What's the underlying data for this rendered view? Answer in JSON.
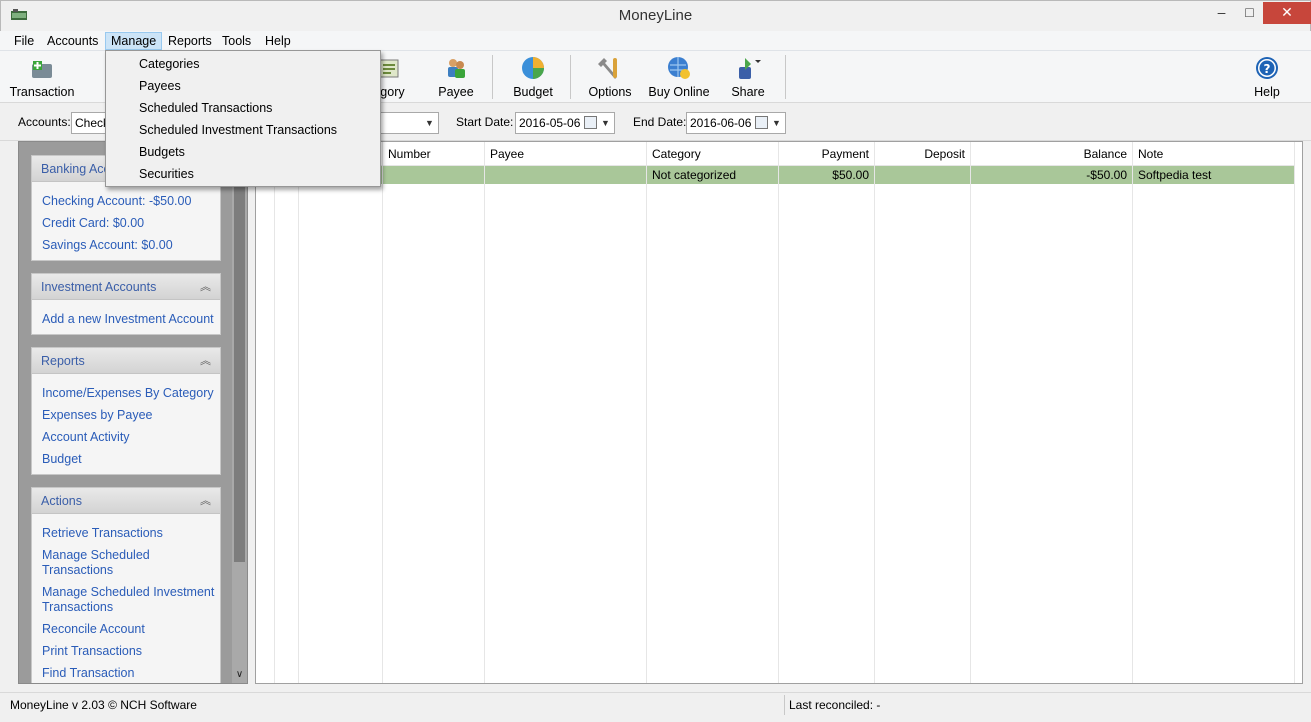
{
  "window": {
    "title": "MoneyLine",
    "min": "–",
    "max": "□",
    "close": "✕"
  },
  "menubar": {
    "items": [
      "File",
      "Accounts",
      "Manage",
      "Reports",
      "Tools",
      "Help"
    ]
  },
  "toolbar": {
    "items": [
      {
        "label": "Transaction",
        "icon": "transaction-icon"
      },
      {
        "label": "egory",
        "icon": "category-icon"
      },
      {
        "label": "Payee",
        "icon": "payee-icon"
      },
      {
        "label": "Budget",
        "icon": "budget-icon"
      },
      {
        "label": "Options",
        "icon": "options-icon"
      },
      {
        "label": "Buy Online",
        "icon": "buy-online-icon"
      },
      {
        "label": "Share",
        "icon": "share-icon"
      },
      {
        "label": "Help",
        "icon": "help-icon"
      }
    ]
  },
  "filter": {
    "accounts_label": "Accounts:",
    "accounts_value": "Check",
    "start_label": "Start Date:",
    "start_value": "2016-05-06",
    "end_label": "End Date:",
    "end_value": "2016-06-06"
  },
  "sidebar": {
    "panels": [
      {
        "title": "Banking Acco",
        "links": [
          "Checking Account: -$50.00",
          "Credit Card: $0.00",
          "Savings Account: $0.00"
        ]
      },
      {
        "title": "Investment Accounts",
        "links": [
          "Add a new Investment Account"
        ]
      },
      {
        "title": "Reports",
        "links": [
          "Income/Expenses By Category",
          "Expenses by Payee",
          "Account Activity",
          "Budget"
        ]
      },
      {
        "title": "Actions",
        "links": [
          "Retrieve Transactions",
          "Manage Scheduled Transactions",
          "Manage Scheduled Investment Transactions",
          "Reconcile Account",
          "Print Transactions",
          "Find Transaction"
        ]
      }
    ]
  },
  "grid": {
    "columns": [
      "Number",
      "Payee",
      "Category",
      "Payment",
      "Deposit",
      "Balance",
      "Note"
    ],
    "rows": [
      {
        "number": "",
        "payee": "",
        "category": "Not categorized",
        "payment": "$50.00",
        "deposit": "",
        "balance": "-$50.00",
        "note": "Softpedia test"
      }
    ]
  },
  "manage_menu": {
    "items": [
      "Categories",
      "Payees",
      "Scheduled Transactions",
      "Scheduled Investment Transactions",
      "Budgets",
      "Securities"
    ]
  },
  "status": {
    "version": "MoneyLine v 2.03 © NCH Software",
    "reconciled": "Last reconciled: -"
  },
  "colors": {
    "row_highlight": "#a9c799",
    "link": "#2a5cb8",
    "close_button": "#c7463b"
  }
}
